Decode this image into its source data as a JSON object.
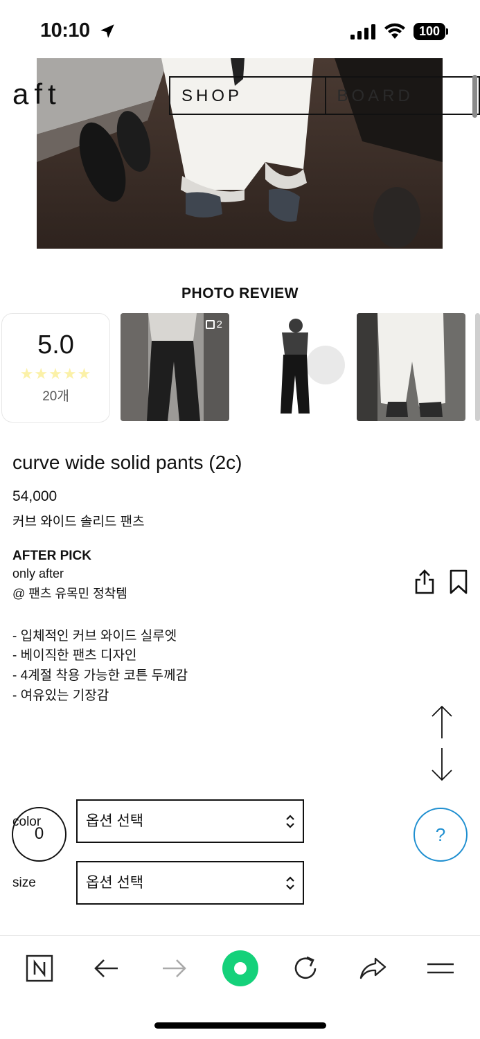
{
  "status_bar": {
    "time": "10:10",
    "battery": "100"
  },
  "header": {
    "logo": "aft",
    "nav": [
      "SHOP",
      "BOARD"
    ]
  },
  "reviews": {
    "title": "PHOTO REVIEW",
    "score": "5.0",
    "stars": "★★★★★",
    "count": "20개",
    "first_photo_badge": "2"
  },
  "product": {
    "name": "curve wide solid pants (2c)",
    "price": "54,000",
    "korean_name": "커브 와이드 솔리드 팬츠",
    "pick_title": "AFTER PICK",
    "pick_line1": "only after",
    "pick_line2": "@ 팬츠 유목민 정착템",
    "features": [
      "- 입체적인 커브 와이드 실루엣",
      "- 베이직한 팬츠 디자인",
      "- 4계절 착용 가능한 코튼 두께감",
      "- 여유있는 기장감"
    ]
  },
  "options": {
    "cart_count": "0",
    "color_label": "color",
    "color_placeholder": "옵션 선택",
    "size_label": "size",
    "size_placeholder": "옵션 선택"
  },
  "help": {
    "label": "?"
  },
  "icons": {
    "status": [
      "location-arrow-icon",
      "signal-icon",
      "wifi-icon",
      "battery-icon"
    ],
    "actions": [
      "share-icon",
      "bookmark-icon",
      "arrow-up-icon",
      "arrow-down-icon"
    ],
    "toolbar": [
      "naver-home-icon",
      "back-icon",
      "forward-icon",
      "green-dot-icon",
      "reload-icon",
      "share-arrow-icon",
      "menu-icon"
    ]
  },
  "colors": {
    "accent_green": "#14d17a",
    "help_blue": "#1f8fd0",
    "star_yellow": "#fbf1a8"
  }
}
